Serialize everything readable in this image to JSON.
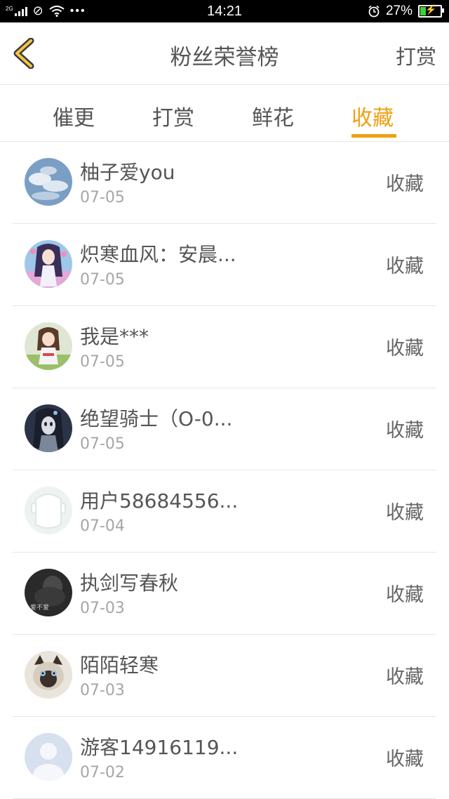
{
  "status_bar": {
    "network": "2G",
    "time": "14:21",
    "battery_percent": "27%",
    "battery_level": 0.27,
    "icons": [
      "signal-icon",
      "no-sim-icon",
      "wifi-icon",
      "more-icon",
      "alarm-icon",
      "battery-icon"
    ]
  },
  "header": {
    "title": "粉丝荣誉榜",
    "action": "打赏",
    "back_icon": "chevron-left-icon",
    "accent_color": "#f0a013"
  },
  "tabs": [
    {
      "label": "催更",
      "active": false
    },
    {
      "label": "打赏",
      "active": false
    },
    {
      "label": "鲜花",
      "active": false
    },
    {
      "label": "收藏",
      "active": true
    }
  ],
  "list": [
    {
      "name": "柚子爱you",
      "date": "07-05",
      "action": "收藏",
      "avatar": "sky-clouds-avatar"
    },
    {
      "name": "炽寒血风：安晨...",
      "date": "07-05",
      "action": "收藏",
      "avatar": "anime-girl-avatar"
    },
    {
      "name": "我是***",
      "date": "07-05",
      "action": "收藏",
      "avatar": "anime-character-avatar"
    },
    {
      "name": "绝望骑士（O-0...",
      "date": "07-05",
      "action": "收藏",
      "avatar": "dark-character-avatar"
    },
    {
      "name": "用户58684556...",
      "date": "07-04",
      "action": "收藏",
      "avatar": "default-user-avatar"
    },
    {
      "name": "执剑写春秋",
      "date": "07-03",
      "action": "收藏",
      "avatar": "dark-photo-avatar"
    },
    {
      "name": "陌陌轻寒",
      "date": "07-03",
      "action": "收藏",
      "avatar": "cat-avatar"
    },
    {
      "name": "游客14916119...",
      "date": "07-02",
      "action": "收藏",
      "avatar": "guest-avatar"
    }
  ],
  "avatar_text": {
    "dark_photo_caption": "爱不爱"
  }
}
